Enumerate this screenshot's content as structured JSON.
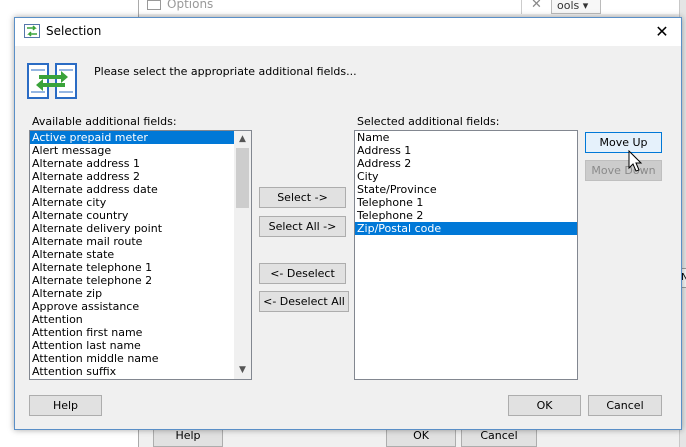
{
  "background_window": {
    "title": "Options",
    "close_glyph": "✕",
    "tools_menu": "ools ▾",
    "help_button": "Help",
    "ok_button": "OK",
    "cancel_button": "Cancel",
    "right_box_text": "N"
  },
  "dialog": {
    "title": "Selection",
    "close_glyph": "✕",
    "instruction": "Please select the appropriate additional fields...",
    "available_label": "Available additional fields:",
    "selected_label": "Selected additional fields:",
    "available_fields": [
      "Active prepaid meter",
      "Alert message",
      "Alternate address 1",
      "Alternate address 2",
      "Alternate address date",
      "Alternate city",
      "Alternate country",
      "Alternate delivery point",
      "Alternate mail route",
      "Alternate state",
      "Alternate telephone 1",
      "Alternate telephone 2",
      "Alternate zip",
      "Approve assistance",
      "Attention",
      "Attention first name",
      "Attention last name",
      "Attention middle name",
      "Attention suffix"
    ],
    "available_selected_index": 0,
    "selected_fields": [
      "Name",
      "Address 1",
      "Address 2",
      "City",
      "State/Province",
      "Telephone 1",
      "Telephone 2",
      "Zip/Postal code"
    ],
    "selected_selected_index": 7,
    "buttons": {
      "select": "Select ->",
      "select_all": "Select All ->",
      "deselect": "<- Deselect",
      "deselect_all": "<- Deselect All",
      "move_up": "Move Up",
      "move_down": "Move Down",
      "help": "Help",
      "ok": "OK",
      "cancel": "Cancel"
    },
    "scroll_up_glyph": "▲",
    "scroll_down_glyph": "▼"
  },
  "colors": {
    "selection": "#0078d7",
    "dialog_border": "#5a8fc7",
    "icon_green": "#3aa33a",
    "icon_blue": "#2b6cc4"
  }
}
